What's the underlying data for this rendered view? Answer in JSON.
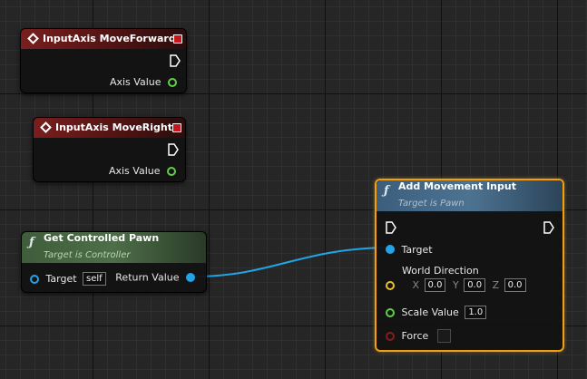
{
  "nodes": {
    "move_forward": {
      "title": "InputAxis MoveForward",
      "output_label": "Axis Value"
    },
    "move_right": {
      "title": "InputAxis MoveRight",
      "output_label": "Axis Value"
    },
    "get_pawn": {
      "title": "Get Controlled Pawn",
      "subtitle": "Target is Controller",
      "target_label": "Target",
      "target_value": "self",
      "output_label": "Return Value"
    },
    "add_movement": {
      "title": "Add Movement Input",
      "subtitle": "Target is Pawn",
      "target_label": "Target",
      "world_direction_label": "World Direction",
      "x_label": "X",
      "x_value": "0.0",
      "y_label": "Y",
      "y_value": "0.0",
      "z_label": "Z",
      "z_value": "0.0",
      "scale_label": "Scale Value",
      "scale_value": "1.0",
      "force_label": "Force"
    }
  },
  "colors": {
    "event_header": "#7a1e1e",
    "pure_function_header": "#4d6e48",
    "function_header": "#4d7392",
    "selection": "#f0a011",
    "object_pin": "#21a5e6",
    "float_pin": "#60d04a",
    "vector_pin": "#e8c22a",
    "bool_pin": "#8c1a1a"
  },
  "icons": {
    "event": "diamond-icon",
    "function": "function-f-icon",
    "delegate": "stop-square-icon",
    "exec": "exec-arrow-icon"
  }
}
